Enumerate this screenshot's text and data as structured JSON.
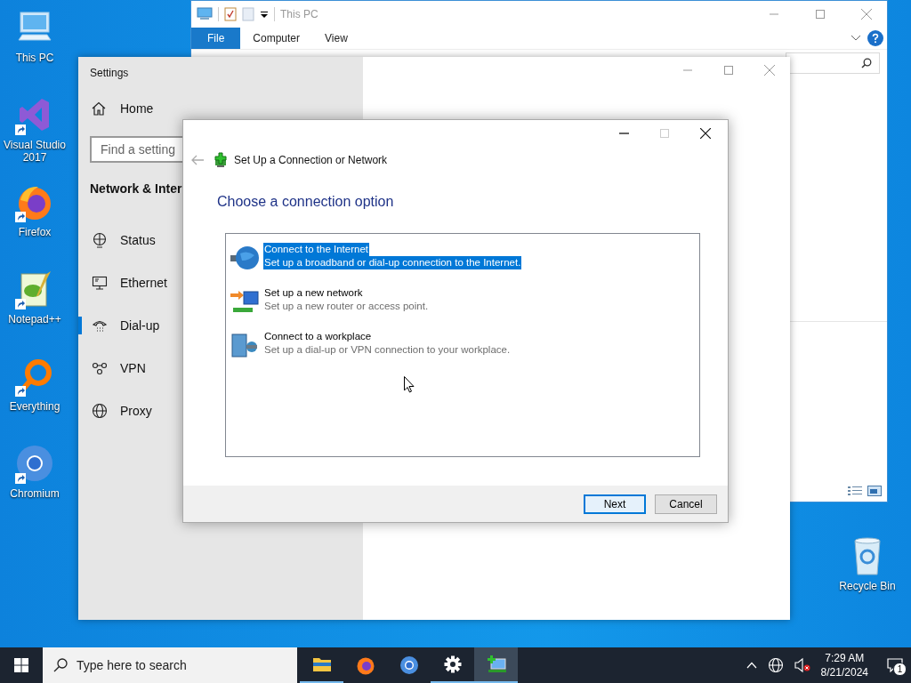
{
  "desktop_icons": [
    {
      "label": "This PC",
      "shortcut": false
    },
    {
      "label": "Visual Studio 2017",
      "shortcut": true
    },
    {
      "label": "Firefox",
      "shortcut": true
    },
    {
      "label": "Notepad++",
      "shortcut": true
    },
    {
      "label": "Everything",
      "shortcut": true
    },
    {
      "label": "Chromium",
      "shortcut": true
    }
  ],
  "recycle_bin": {
    "label": "Recycle Bin"
  },
  "explorer": {
    "title": "This PC",
    "ribbon_tabs": [
      {
        "label": "File",
        "selected": true
      },
      {
        "label": "Computer",
        "selected": false
      },
      {
        "label": "View",
        "selected": false
      }
    ]
  },
  "settings": {
    "title": "Settings",
    "home": "Home",
    "search": {
      "placeholder": "Find a setting"
    },
    "section": "Network & Inter",
    "nav": [
      {
        "label": "Status",
        "selected": false
      },
      {
        "label": "Ethernet",
        "selected": false
      },
      {
        "label": "Dial-up",
        "selected": true
      },
      {
        "label": "VPN",
        "selected": false
      },
      {
        "label": "Proxy",
        "selected": false
      }
    ]
  },
  "dialog": {
    "title": "Set Up a Connection or Network",
    "heading": "Choose a connection option",
    "options": [
      {
        "title": "Connect to the Internet",
        "description": "Set up a broadband or dial-up connection to the Internet.",
        "selected": true
      },
      {
        "title": "Set up a new network",
        "description": "Set up a new router or access point.",
        "selected": false
      },
      {
        "title": "Connect to a workplace",
        "description": "Set up a dial-up or VPN connection to your workplace.",
        "selected": false
      }
    ],
    "buttons": [
      {
        "label": "Next",
        "default": true
      },
      {
        "label": "Cancel",
        "default": false
      }
    ]
  },
  "taskbar": {
    "search": {
      "placeholder": "Type here to search"
    },
    "apps": [
      {
        "running": true,
        "active": false
      },
      {
        "running": false,
        "active": false
      },
      {
        "running": false,
        "active": false
      },
      {
        "running": true,
        "active": false
      },
      {
        "running": true,
        "active": true
      }
    ],
    "time": "7:29 AM",
    "date": "8/21/2024",
    "notifications": "1"
  }
}
